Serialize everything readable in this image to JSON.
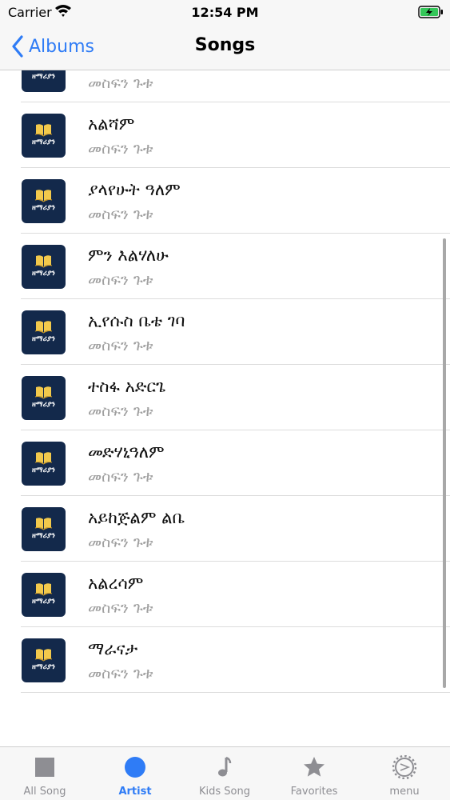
{
  "status_bar": {
    "carrier": "Carrier",
    "time": "12:54 PM"
  },
  "nav": {
    "back_label": "Albums",
    "title": "Songs"
  },
  "thumbnail_text": "ዘማሪያን",
  "songs": [
    {
      "title": "",
      "artist": "መስፍን ጉቱ"
    },
    {
      "title": "አልሻም",
      "artist": "መስፍን ጉቱ"
    },
    {
      "title": "ያላየሁት ዓለም",
      "artist": "መስፍን ጉቱ"
    },
    {
      "title": "ምን እልሃለሁ",
      "artist": "መስፍን ጉቱ"
    },
    {
      "title": "ኢየሱስ ቤቴ ገባ",
      "artist": "መስፍን ጉቱ"
    },
    {
      "title": "ተስፋ አድርጌ",
      "artist": "መስፍን ጉቱ"
    },
    {
      "title": "መድሃኒዓለም",
      "artist": "መስፍን ጉቱ"
    },
    {
      "title": "አይከጅልም ልቤ",
      "artist": "መስፍን ጉቱ"
    },
    {
      "title": "አልረሳም",
      "artist": "መስፍን ጉቱ"
    },
    {
      "title": "ማራናታ",
      "artist": "መስፍን ጉቱ"
    }
  ],
  "tabs": [
    {
      "label": "All Song",
      "icon": "square-icon",
      "active": false
    },
    {
      "label": "Artist",
      "icon": "circle-icon",
      "active": true
    },
    {
      "label": "Kids Song",
      "icon": "music-note-icon",
      "active": false
    },
    {
      "label": "Favorites",
      "icon": "star-icon",
      "active": false
    },
    {
      "label": "menu",
      "icon": "gear-icon",
      "active": false
    }
  ],
  "colors": {
    "accent": "#2f7cf6",
    "thumbnail_bg": "#13294b",
    "inactive_tab": "#8e8e93"
  }
}
